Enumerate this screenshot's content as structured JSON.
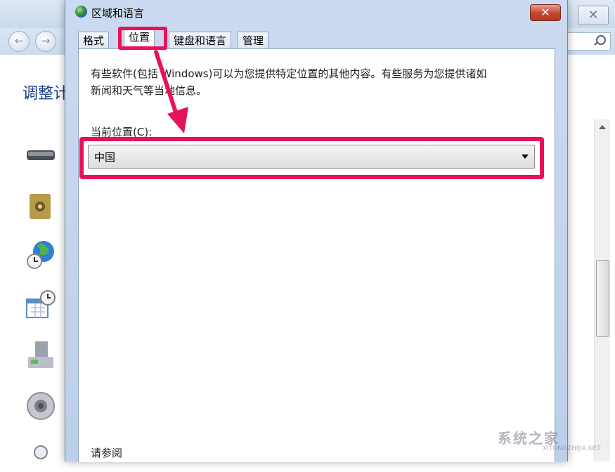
{
  "background_window": {
    "heading": "调整计",
    "close_label": "✕",
    "back_label": "←",
    "forward_label": "→"
  },
  "dialog": {
    "title": "区域和语言",
    "close_label": "✕",
    "tabs": [
      {
        "label": "格式",
        "active": false
      },
      {
        "label": "位置",
        "active": true
      },
      {
        "label": "键盘和语言",
        "active": false
      },
      {
        "label": "管理",
        "active": false
      }
    ],
    "description_line1": "有些软件(包括 Windows)可以为您提供特定位置的其他内容。有些服务为您提供诸如",
    "description_line2": "新闻和天气等当地信息。",
    "current_location_label": "当前位置(C):",
    "current_location_value": "中国",
    "see_also": "请参阅"
  },
  "watermark": {
    "text": "系统之家",
    "sub": "XITONGZHIJIA.NET"
  },
  "colors": {
    "annotation": "#e8125c",
    "close_button": "#c24530",
    "heading_blue": "#1e3f8f"
  }
}
